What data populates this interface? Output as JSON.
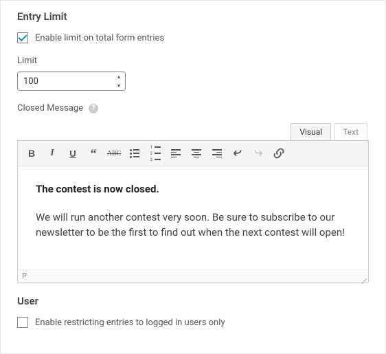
{
  "entryLimit": {
    "title": "Entry Limit",
    "enable": {
      "label": "Enable limit on total form entries",
      "checked": true
    },
    "limit": {
      "label": "Limit",
      "value": "100"
    },
    "closedMessage": {
      "label": "Closed Message"
    }
  },
  "editor": {
    "tabs": {
      "visual": "Visual",
      "text": "Text",
      "active": "visual"
    },
    "content": {
      "heading": "The contest is now closed.",
      "paragraph": "We will run another contest very soon. Be sure to subscribe to our newsletter to be the first to find out when the next contest will open!"
    },
    "statusPath": "P"
  },
  "user": {
    "title": "User",
    "restrict": {
      "label": "Enable restricting entries to logged in users only",
      "checked": false
    }
  }
}
